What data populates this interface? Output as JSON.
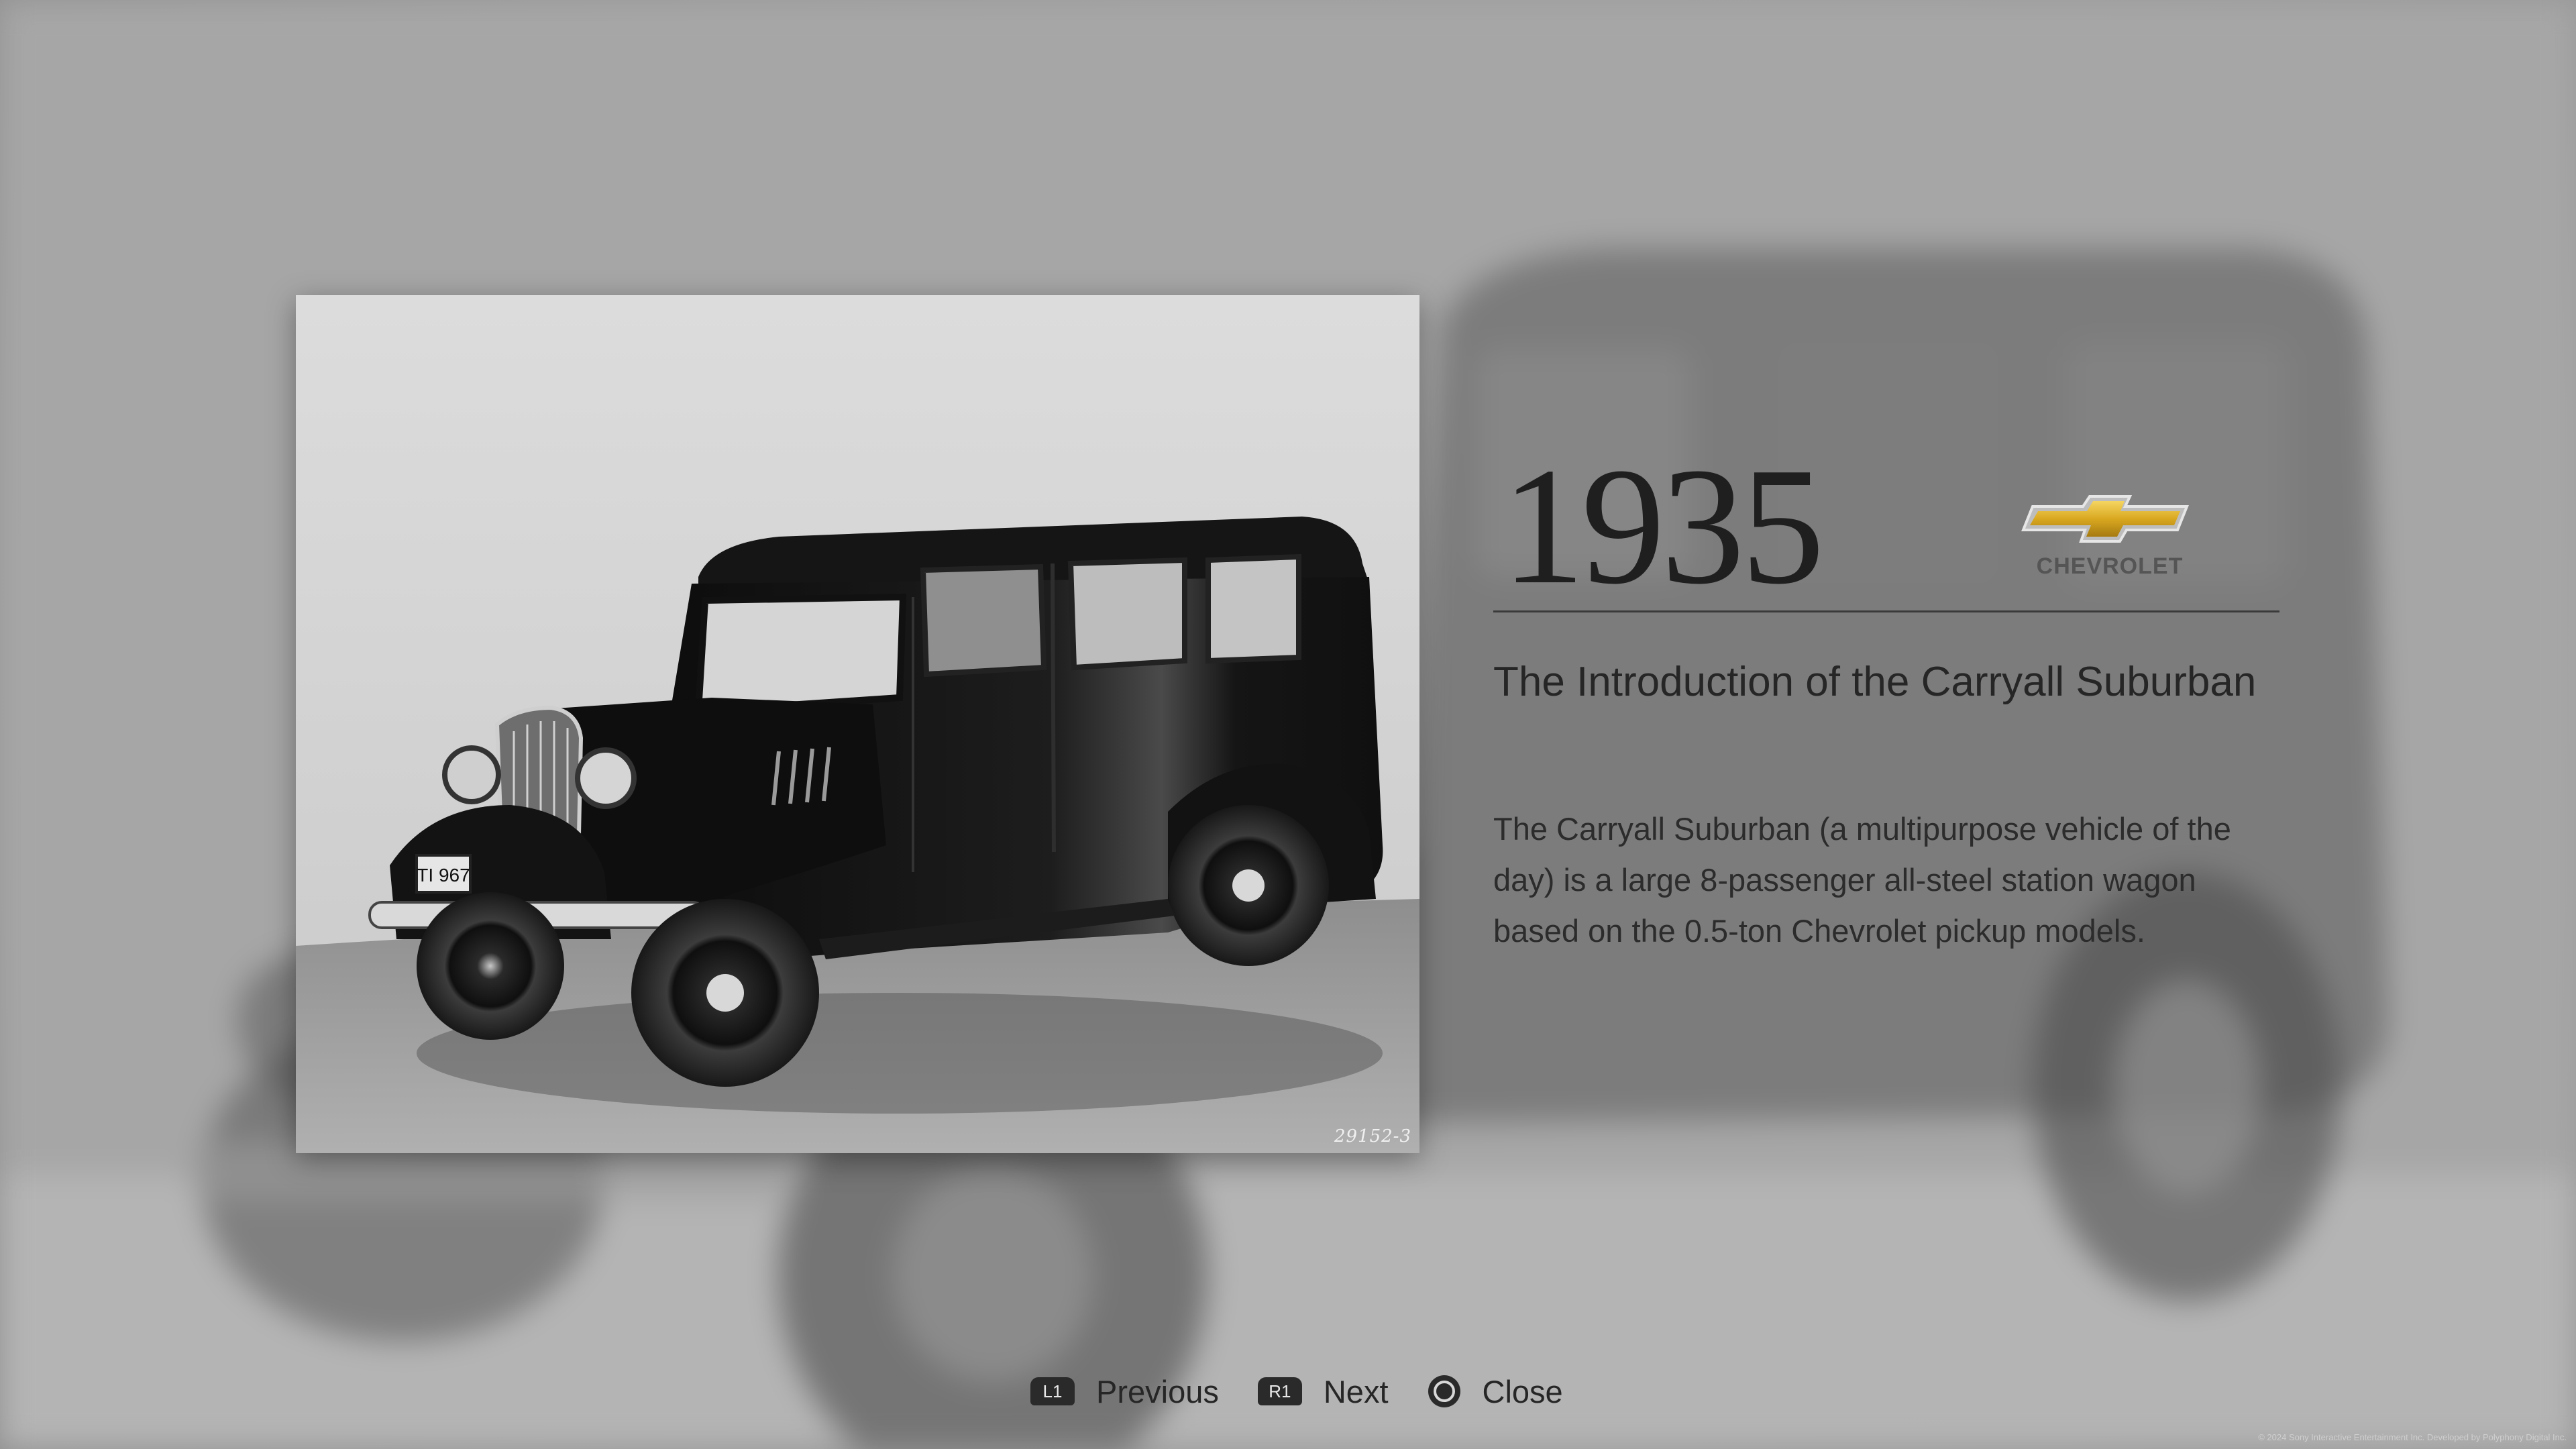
{
  "photo": {
    "alt": "1935 Chevrolet Carryall Suburban",
    "negative_code": "29152-3",
    "plate": "TI 967"
  },
  "info": {
    "year": "1935",
    "brand": "CHEVROLET",
    "headline": "The Introduction of the Carryall Suburban",
    "body": "The Carryall Suburban (a multipurpose vehicle of the day) is a large 8-passenger all-steel station wagon based on the 0.5-ton Chevrolet pickup models."
  },
  "controls": {
    "previous": {
      "key": "L1",
      "label": "Previous"
    },
    "next": {
      "key": "R1",
      "label": "Next"
    },
    "close": {
      "key": "circle-icon",
      "label": "Close"
    }
  },
  "footer": {
    "copyright": "© 2024 Sony Interactive Entertainment Inc. Developed by Polyphony Digital Inc."
  },
  "colors": {
    "background": "#a5a5a5",
    "text": "#262626",
    "badge": "#2a2a2a",
    "logo_gold": "#d9a820"
  }
}
